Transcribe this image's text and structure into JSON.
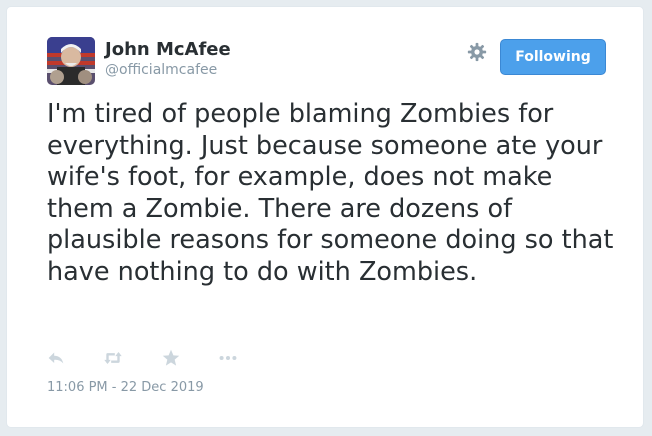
{
  "tweet": {
    "author_name": "John McAfee",
    "author_handle": "@officialmcafee",
    "follow_button_label": "Following",
    "text": "I'm tired of people blaming Zombies for everything. Just because someone ate your wife's foot, for example, does not make them a Zombie. There are dozens of plausible reasons for someone doing so that have nothing to do with Zombies.",
    "timestamp": "11:06 PM - 22 Dec 2019"
  },
  "icons": {
    "settings": "gear-icon",
    "reply": "reply-icon",
    "retweet": "retweet-icon",
    "favorite": "star-icon",
    "more": "more-dots-icon"
  },
  "colors": {
    "accent": "#4ca0eb",
    "text": "#292f33",
    "muted": "#8899a6",
    "icon": "#ccd6dd",
    "background": "#e6ecf0"
  }
}
